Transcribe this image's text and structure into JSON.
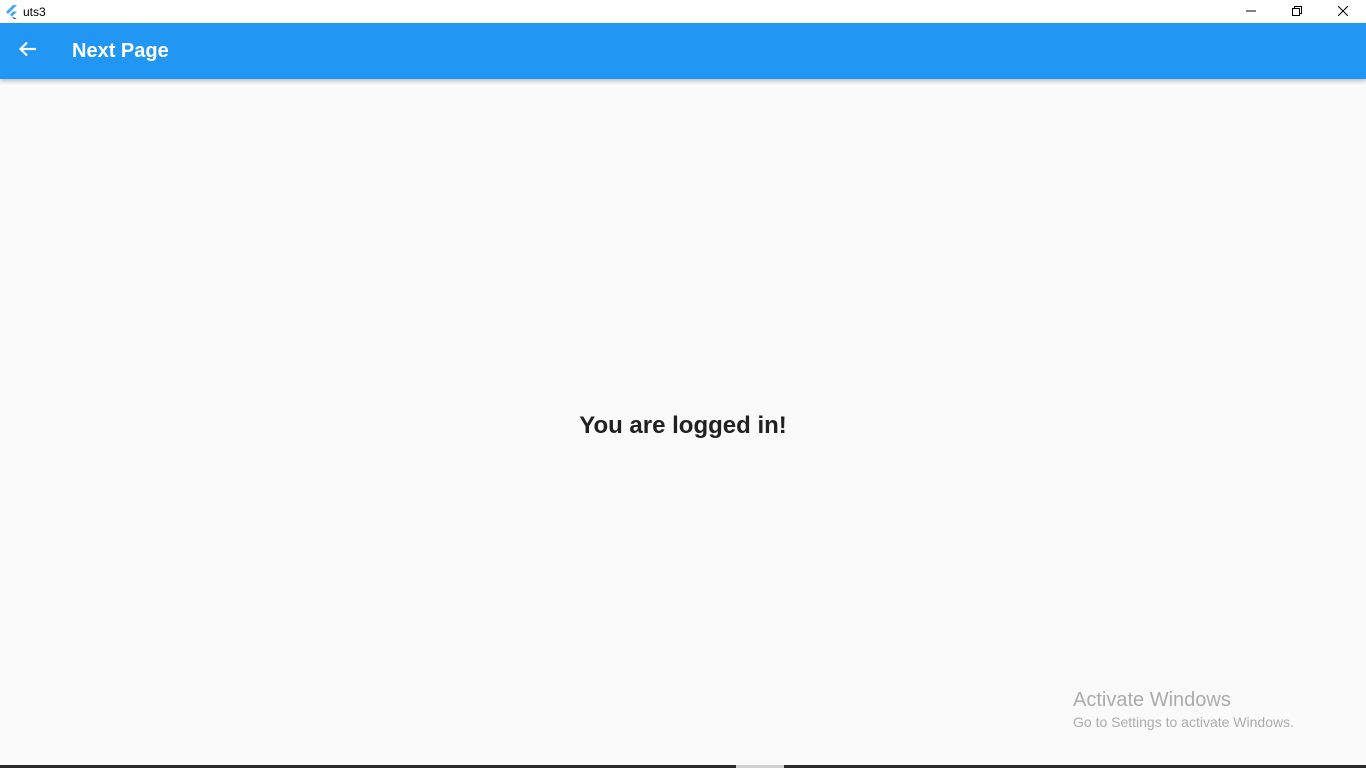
{
  "window": {
    "title": "uts3",
    "controls": {
      "minimize_icon": "minimize-icon",
      "restore_icon": "restore-icon",
      "close_icon": "close-icon"
    }
  },
  "appbar": {
    "title": "Next Page",
    "back_icon": "arrow-back-icon",
    "color": "#2196f3"
  },
  "main": {
    "message": "You are logged in!"
  },
  "watermark": {
    "title": "Activate Windows",
    "subtitle": "Go to Settings to activate Windows."
  }
}
